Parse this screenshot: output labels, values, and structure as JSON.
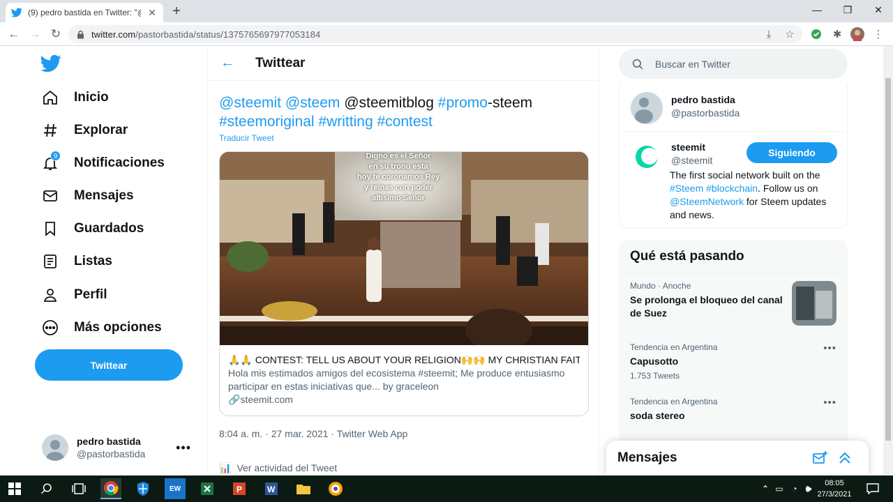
{
  "browser": {
    "tab_title": "(9) pedro bastida en Twitter: \"@s",
    "url_host": "twitter.com",
    "url_path": "/pastorbastida/status/1375765697977053184"
  },
  "sidebar": {
    "items": [
      {
        "label": "Inicio",
        "icon": "home-icon"
      },
      {
        "label": "Explorar",
        "icon": "hashtag-icon"
      },
      {
        "label": "Notificaciones",
        "icon": "bell-icon",
        "badge": "9"
      },
      {
        "label": "Mensajes",
        "icon": "mail-icon"
      },
      {
        "label": "Guardados",
        "icon": "bookmark-icon"
      },
      {
        "label": "Listas",
        "icon": "list-icon"
      },
      {
        "label": "Perfil",
        "icon": "person-icon"
      },
      {
        "label": "Más opciones",
        "icon": "more-circle-icon"
      }
    ],
    "tweet_button": "Twittear",
    "account": {
      "name": "pedro bastida",
      "handle": "@pastorbastida"
    }
  },
  "header": {
    "title": "Twittear"
  },
  "tweet": {
    "parts": [
      "@steemit",
      " ",
      "@steem",
      " @steemitblog ",
      "#promo",
      "-steem",
      "#steemoriginal",
      " ",
      "#writting",
      " ",
      "#contest"
    ],
    "translate": "Traducir Tweet",
    "image_text": [
      "Digno es el Señor",
      "en su trono esta",
      "hoy te coronamos Rey",
      "y reinas con poder",
      "altísimo Señor"
    ],
    "card_title": "🙏🙏 CONTEST: TELL US ABOUT YOUR RELIGION🙌🙌 MY CHRISTIAN FAITH//.🙏",
    "card_desc": "Hola mis estimados amigos del ecosistema #steemit; Me produce entusiasmo participar en estas iniciativas que... by graceleon",
    "card_link": "steemit.com",
    "meta": "8:04 a. m. · 27 mar. 2021 · Twitter Web App",
    "activity": "Ver actividad del Tweet"
  },
  "right": {
    "search_placeholder": "Buscar en Twitter",
    "user1": {
      "name": "pedro bastida",
      "handle": "@pastorbastida"
    },
    "user2": {
      "name": "steemit",
      "handle": "@steemit",
      "follow": "Siguiendo",
      "bio": [
        "The first social network built on the ",
        "#Steem",
        " ",
        "#blockchain",
        ". Follow us on ",
        "@SteemNetwork",
        " for Steem updates and news."
      ]
    },
    "trends_title": "Qué está pasando",
    "trends": [
      {
        "context": "Mundo · Anoche",
        "name": "Se prolonga el bloqueo del canal de Suez",
        "count": ""
      },
      {
        "context": "Tendencia en Argentina",
        "name": "Capusotto",
        "count": "1.753 Tweets"
      },
      {
        "context": "Tendencia en Argentina",
        "name": "soda stereo",
        "count": ""
      }
    ],
    "messages_title": "Mensajes"
  },
  "taskbar": {
    "time": "08:05",
    "date": "27/3/2021"
  },
  "colors": {
    "accent": "#1d9bf0",
    "text": "#0f1419",
    "secondary": "#536471"
  }
}
